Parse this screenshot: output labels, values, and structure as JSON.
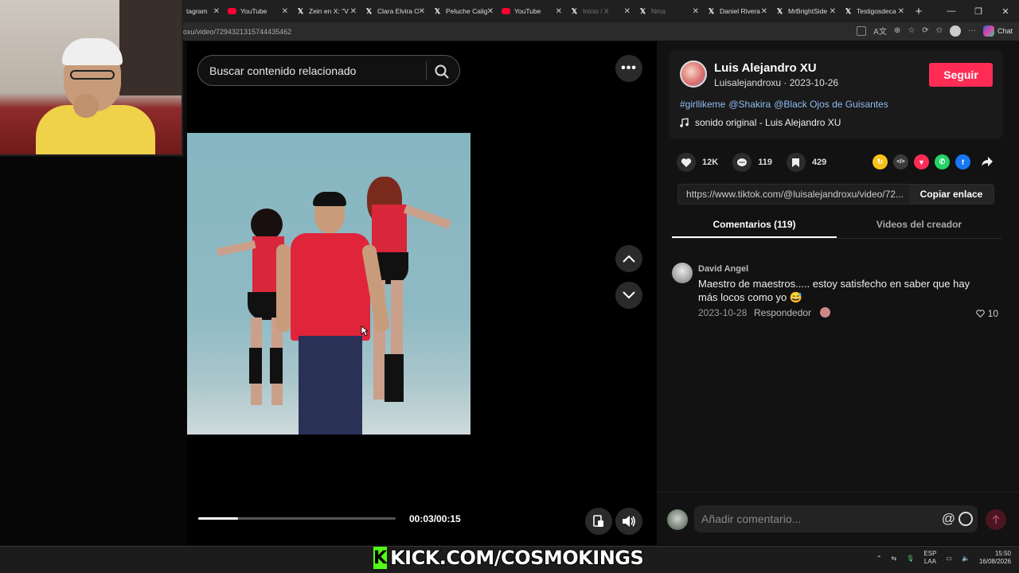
{
  "browser": {
    "tabs": [
      {
        "label": "tagram",
        "icon": "instagram",
        "dim": false
      },
      {
        "label": "YouTube",
        "icon": "youtube",
        "dim": false
      },
      {
        "label": "Zein en X: \"V",
        "icon": "x",
        "dim": false
      },
      {
        "label": "Clara Elvira O",
        "icon": "x",
        "dim": false
      },
      {
        "label": "Peluche Calig",
        "icon": "x",
        "dim": false
      },
      {
        "label": "YouTube",
        "icon": "youtube",
        "dim": false
      },
      {
        "label": "Inicio / X",
        "icon": "x",
        "dim": true
      },
      {
        "label": "Nma",
        "icon": "x",
        "dim": true
      },
      {
        "label": "Daniel Rivera",
        "icon": "x",
        "dim": false
      },
      {
        "label": "MrBrightSide",
        "icon": "x",
        "dim": false
      },
      {
        "label": "Testigosdeca",
        "icon": "x",
        "dim": false
      }
    ],
    "url": "oxu/video/7294321315744435462",
    "chat_label": "Chat"
  },
  "video_panel": {
    "search_placeholder": "Buscar contenido relacionado",
    "timecode": "00:03/00:15",
    "progress": 0.2
  },
  "author": {
    "name": "Luis Alejandro XU",
    "subtitle": "Luisalejandroxu · 2023-10-26",
    "follow_label": "Seguir",
    "tags": [
      "#girllikeme",
      "@Shakira",
      "@Black Ojos de Guisantes"
    ],
    "sound": "sonido original - Luis Alejandro XU"
  },
  "stats": {
    "likes": "12K",
    "comments": "119",
    "saves": "429"
  },
  "share": {
    "link": "https://www.tiktok.com/@luisalejandroxu/video/72...",
    "copy_label": "Copiar enlace",
    "icons": [
      {
        "name": "repost",
        "color": "#f7c21a",
        "glyph": "↻"
      },
      {
        "name": "embed",
        "color": "#3a3a3a",
        "glyph": "</>"
      },
      {
        "name": "send-friend",
        "color": "#fe2c55",
        "glyph": "▼"
      },
      {
        "name": "whatsapp",
        "color": "#25d366",
        "glyph": "✆"
      },
      {
        "name": "facebook",
        "color": "#1877f2",
        "glyph": "f"
      }
    ]
  },
  "comment_tabs": {
    "comments": "Comentarios (119)",
    "creator_videos": "Videos del creador"
  },
  "comment": {
    "author": "David Angel",
    "text": "Maestro de maestros..... estoy satisfecho en saber que hay más locos como yo 😅",
    "date": "2023-10-28",
    "reply_label": "Respondedor",
    "likes": "10"
  },
  "composer": {
    "placeholder": "Añadir comentario..."
  },
  "banner": {
    "text": "KICK.COM/COSMOKINGS"
  },
  "taskbar": {
    "lang_1": "ESP",
    "lang_2": "LAA",
    "time": "15:50",
    "date": "16/08/2026"
  },
  "colors": {
    "accent": "#fe2c55",
    "tag_link": "#8fbcf2",
    "kick_green": "#53fc18"
  }
}
